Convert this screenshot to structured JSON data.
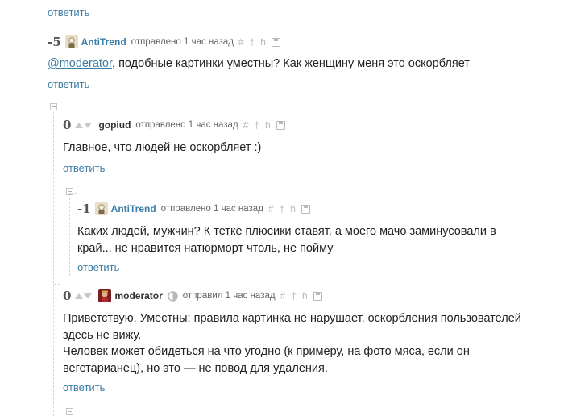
{
  "reply_label": "ответить",
  "comments": [
    {
      "rating": "-5",
      "author": "AntiTrend",
      "time": "отправлено 1 час назад",
      "author_color": "#3d7ea6",
      "mention": "@moderator",
      "text": ", подобные картинки уместны? Как женщину меня это оскорбляет"
    },
    {
      "rating": "0",
      "author": "gopiud",
      "time": "отправлено 1 час назад",
      "author_color": "#333333",
      "text": "Главное, что людей не оскорбляет :)"
    },
    {
      "rating": "-1",
      "author": "AntiTrend",
      "time": "отправлено 1 час назад",
      "author_color": "#3d7ea6",
      "text_line1": "Каких людей, мужчин? К тетке плюсики ставят, а моего мачо заминусовали в",
      "text_line2": "край... не нравится натюрморт чтоль, не пойму"
    },
    {
      "rating": "0",
      "author": "moderator",
      "time": "отправил 1 час назад",
      "author_color": "#333333",
      "text_line1": "Приветствую. Уместны: правила картинка не нарушает, оскорбления пользователей",
      "text_line2": "здесь не вижу.",
      "text_line3": "Человек может обидеться на что угодно (к примеру, на фото мяса, если он",
      "text_line4": "вегетарианец), но это — не повод для удаления."
    }
  ],
  "action_icons": [
    "hash-icon",
    "pin-icon",
    "branch-icon",
    "save-icon"
  ],
  "colors": {
    "link": "#3d7ea6",
    "text": "#222222",
    "muted": "#666666",
    "icon": "#b8b8b8",
    "thread_line": "#d6d6d6"
  }
}
